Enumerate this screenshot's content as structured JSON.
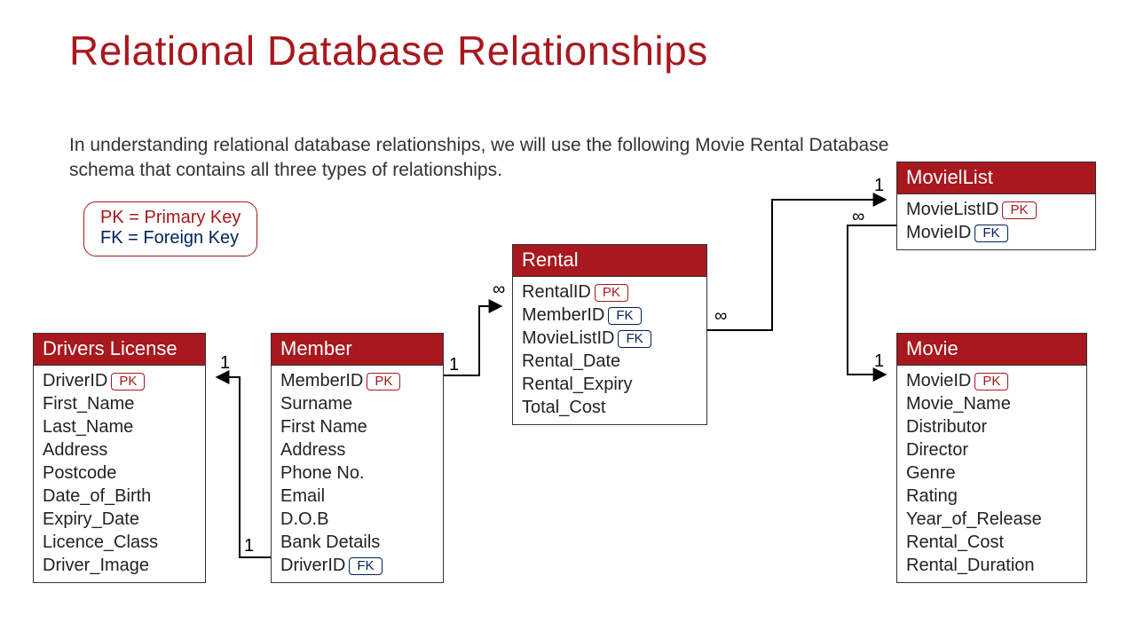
{
  "title": "Relational Database Relationships",
  "intro": "In understanding relational database relationships, we will use the following Movie Rental Database schema that contains all three types of relationships.",
  "legend": {
    "pk": "PK = Primary Key",
    "fk": "FK = Foreign Key"
  },
  "keys": {
    "pk": "PK",
    "fk": "FK"
  },
  "cardinality": {
    "one": "1",
    "many": "∞"
  },
  "entities": {
    "drivers": {
      "title": "Drivers License",
      "fields": [
        "DriverID",
        "First_Name",
        "Last_Name",
        "Address",
        "Postcode",
        "Date_of_Birth",
        "Expiry_Date",
        "Licence_Class",
        "Driver_Image"
      ],
      "keys": {
        "DriverID": "pk"
      }
    },
    "member": {
      "title": "Member",
      "fields": [
        "MemberID",
        "Surname",
        "First Name",
        "Address",
        "Phone No.",
        "Email",
        "D.O.B",
        "Bank Details",
        "DriverID"
      ],
      "keys": {
        "MemberID": "pk",
        "DriverID": "fk"
      }
    },
    "rental": {
      "title": "Rental",
      "fields": [
        "RentalID",
        "MemberID",
        "MovieListID",
        "Rental_Date",
        "Rental_Expiry",
        "Total_Cost"
      ],
      "keys": {
        "RentalID": "pk",
        "MemberID": "fk",
        "MovieListID": "fk"
      }
    },
    "movielist": {
      "title": "MovielList",
      "fields": [
        "MovieListID",
        "MovieID"
      ],
      "keys": {
        "MovieListID": "pk",
        "MovieID": "fk"
      }
    },
    "movie": {
      "title": "Movie",
      "fields": [
        "MovieID",
        "Movie_Name",
        "Distributor",
        "Director",
        "Genre",
        "Rating",
        "Year_of_Release",
        "Rental_Cost",
        "Rental_Duration"
      ],
      "keys": {
        "MovieID": "pk"
      }
    }
  }
}
